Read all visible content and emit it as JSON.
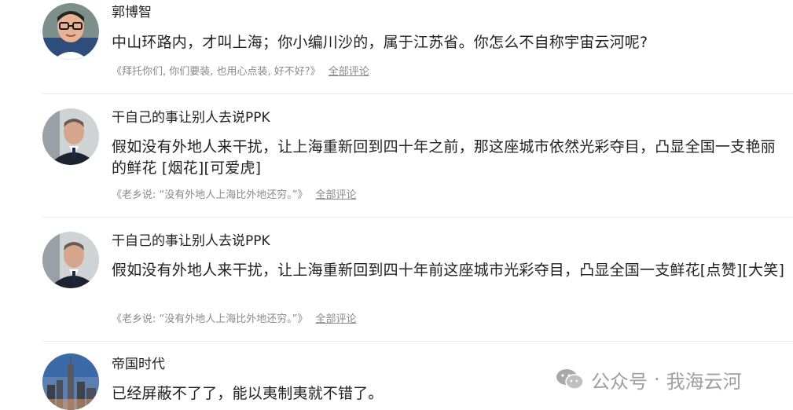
{
  "comments": [
    {
      "author": "郭博智",
      "text": "中山环路内，才叫上海；你小编川沙的，属于江苏省。你怎么不自称宇宙云河呢?",
      "quote": "《拜托你们, 你们要装, 也用心点装, 好不好?》",
      "link": "全部评论"
    },
    {
      "author": "干自己的事让别人去说PPK",
      "text": "假如没有外地人来干扰，让上海重新回到四十年之前，那这座城市依然光彩夺目，凸显全国一支艳丽的鲜花 [烟花][可爱虎]",
      "quote": "《老乡说: “没有外地人上海比外地还穷。”》",
      "link": "全部评论"
    },
    {
      "author": "干自己的事让别人去说PPK",
      "text": "假如没有外地人来干扰，让上海重新回到四十年前这座城市光彩夺目，凸显全国一支鲜花[点赞][大笑]",
      "quote": "《老乡说: “没有外地人上海比外地还穷。”》",
      "link": "全部评论"
    },
    {
      "author": "帝国时代",
      "text": "已经屏蔽不了了，能以夷制夷就不错了。"
    }
  ],
  "watermark": {
    "icon": "wechat-icon",
    "label": "公众号",
    "separator": "·",
    "account": "我海云河"
  },
  "colors": {
    "text": "#222222",
    "meta": "#8a8a8a",
    "divider": "#e8e8e8",
    "watermark": "#8e8e8e"
  }
}
